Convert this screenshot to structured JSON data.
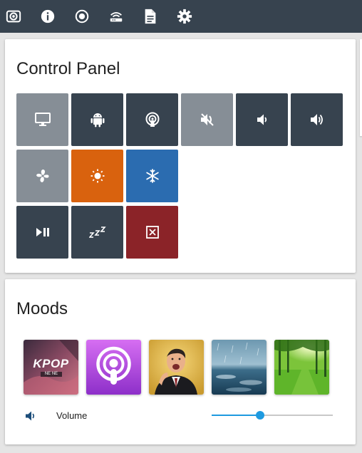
{
  "toolbar": {
    "icons": [
      "camera-icon",
      "info-icon",
      "radio-icon",
      "router-icon",
      "document-icon",
      "settings-icon"
    ]
  },
  "control_panel": {
    "title": "Control Panel",
    "tiles": [
      {
        "name": "tv-tile",
        "icon": "monitor-icon",
        "color": "#868e96"
      },
      {
        "name": "android-tile",
        "icon": "android-icon",
        "color": "#37434f"
      },
      {
        "name": "airplay-tile",
        "icon": "airplay-icon",
        "color": "#37434f"
      },
      {
        "name": "mute-tile",
        "icon": "volume-mute-icon",
        "color": "#868e96"
      },
      {
        "name": "volume-down-tile",
        "icon": "volume-low-icon",
        "color": "#37434f"
      },
      {
        "name": "volume-up-tile",
        "icon": "volume-high-icon",
        "color": "#37434f"
      },
      {
        "name": "fan-tile",
        "icon": "fan-icon",
        "color": "#868e96"
      },
      {
        "name": "heat-tile",
        "icon": "sun-icon",
        "color": "#d9620e"
      },
      {
        "name": "cool-tile",
        "icon": "snowflake-icon",
        "color": "#2b6cb0"
      },
      {
        "name": "play-pause-tile",
        "icon": "play-pause-icon",
        "color": "#37434f"
      },
      {
        "name": "sleep-tile",
        "icon": "sleep-icon",
        "color": "#37434f"
      },
      {
        "name": "close-tile",
        "icon": "close-box-icon",
        "color": "#8b2328"
      }
    ]
  },
  "moods": {
    "title": "Moods",
    "items": [
      {
        "name": "kpop-mood",
        "text": "KPOP",
        "subtext": "NE NE"
      },
      {
        "name": "podcasts-mood"
      },
      {
        "name": "comedy-mood"
      },
      {
        "name": "rain-mood"
      },
      {
        "name": "forest-mood"
      }
    ],
    "volume": {
      "label": "Volume",
      "level": 0.4,
      "icon": "volume-icon",
      "accent": "#1e9ae0"
    }
  }
}
